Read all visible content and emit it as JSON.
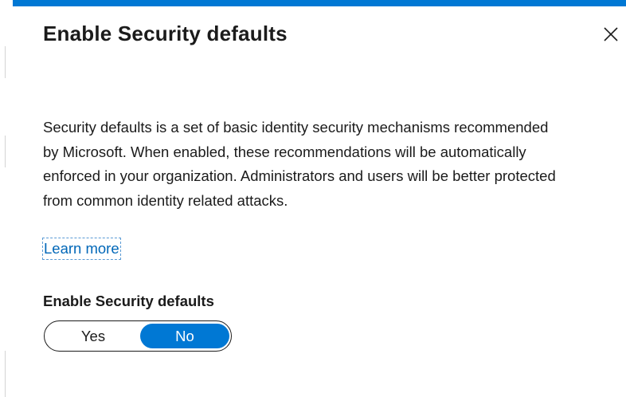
{
  "panel": {
    "title": "Enable Security defaults",
    "description": "Security defaults is a set of basic identity security mechanisms recommended by Microsoft. When enabled, these recommendations will be automatically enforced in your organization. Administrators and users will be better protected from common identity related attacks.",
    "learn_more": "Learn more",
    "close_icon": "close-icon"
  },
  "setting": {
    "label": "Enable Security defaults",
    "options": [
      "Yes",
      "No"
    ],
    "selected": "No"
  },
  "colors": {
    "accent": "#0078d4",
    "link": "#0067b8",
    "text": "#1b1b1b"
  }
}
